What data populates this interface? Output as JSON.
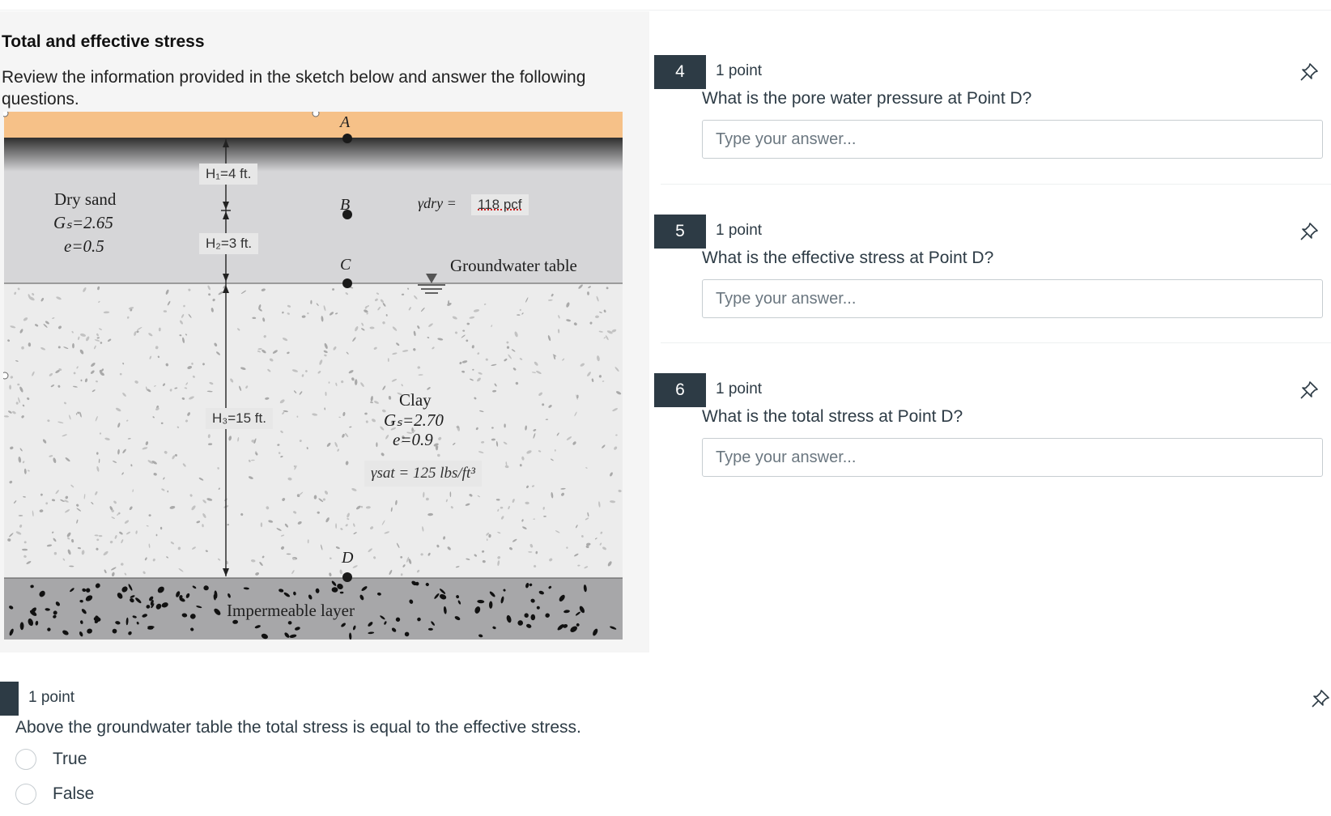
{
  "section": {
    "title": "Total and effective stress",
    "intro": "Review the information provided in the sketch below and answer the following questions."
  },
  "diagram": {
    "points": [
      "A",
      "B",
      "C",
      "D"
    ],
    "dry_sand": {
      "name": "Dry sand",
      "gs": "Gₛ=2.65",
      "e": "e=0.5"
    },
    "h1": "H₁=4 ft.",
    "h2": "H₂=3 ft.",
    "h3": "H₃=15 ft.",
    "gamma_dry_symbol": "γdry =",
    "gamma_dry_value": "118 pcf",
    "groundwater_label": "Groundwater table",
    "clay": {
      "name": "Clay",
      "gs": "Gₛ=2.70",
      "e": "e=0.9"
    },
    "gamma_sat": "γsat = 125 lbs/ft³",
    "impermeable_label": "Impermeable layer",
    "colors": {
      "topsoil": "#f6c188",
      "dry_sand": "#d6d6d8",
      "clay": "#ececec",
      "impermeable": "#a7a7a9"
    }
  },
  "questions": [
    {
      "number": "4",
      "points": "1 point",
      "text": "What is the pore water pressure at Point D?",
      "placeholder": "Type your answer...",
      "value": ""
    },
    {
      "number": "5",
      "points": "1 point",
      "text": "What is the effective stress at Point D?",
      "placeholder": "Type your answer...",
      "value": ""
    },
    {
      "number": "6",
      "points": "1 point",
      "text": "What is the total stress at Point D?",
      "placeholder": "Type your answer...",
      "value": ""
    }
  ],
  "tf_question": {
    "points": "1 point",
    "text": "Above the groundwater table the total stress is equal to the effective stress.",
    "options": [
      "True",
      "False"
    ]
  },
  "icons": {
    "pin": "pin-icon"
  }
}
